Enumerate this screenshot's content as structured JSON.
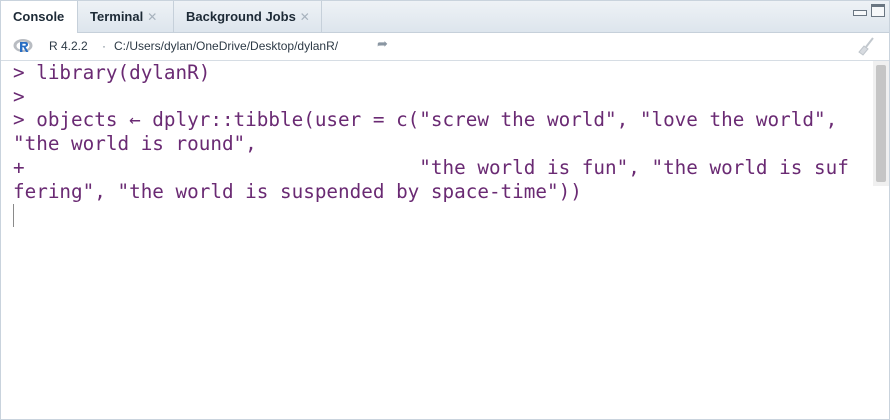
{
  "tabs": [
    {
      "label": "Console"
    },
    {
      "label": "Terminal"
    },
    {
      "label": "Background Jobs"
    }
  ],
  "info": {
    "r_version": "R 4.2.2",
    "separator": "·",
    "working_dir": "C:/Users/dylan/OneDrive/Desktop/dylanR/"
  },
  "console": {
    "lines": [
      "> library(dylanR)",
      ">",
      "> objects ← dplyr::tibble(user = c(\"screw the world\", \"love the world\",",
      "\"the world is round\",",
      "+                                  \"the world is fun\", \"the world is suf",
      "fering\", \"the world is suspended by space-time\"))"
    ]
  },
  "icons": {
    "r_logo": "r-logo-icon",
    "goto": "arrow-icon",
    "clear": "broom-icon",
    "close": "close-icon"
  },
  "colors": {
    "console_text": "#6a2a73",
    "r_logo_blue": "#276dc3"
  }
}
